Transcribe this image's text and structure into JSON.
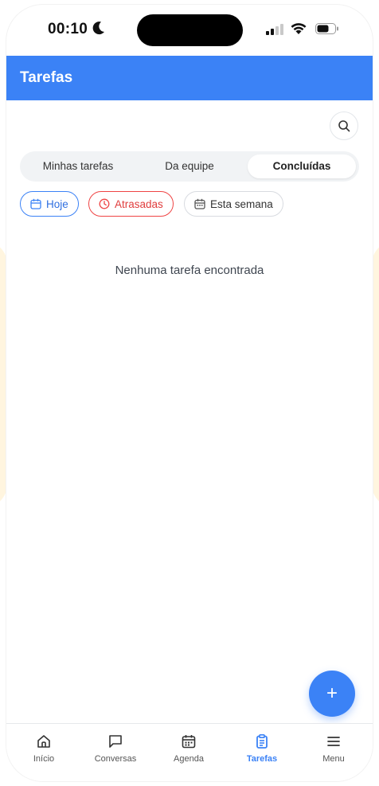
{
  "status_bar": {
    "time": "00:10"
  },
  "header": {
    "title": "Tarefas"
  },
  "segments": [
    {
      "label": "Minhas tarefas"
    },
    {
      "label": "Da equipe"
    },
    {
      "label": "Concluídas",
      "active": true
    }
  ],
  "filters": [
    {
      "label": "Hoje",
      "icon": "calendar-icon",
      "color": "#3b82f6"
    },
    {
      "label": "Atrasadas",
      "icon": "clock-icon",
      "color": "#ef4444"
    },
    {
      "label": "Esta semana",
      "icon": "calendar-week-icon",
      "color": "#555555"
    }
  ],
  "empty_state": {
    "message": "Nenhuma tarefa encontrada"
  },
  "fab": {
    "label": "+"
  },
  "tabbar": {
    "items": [
      {
        "label": "Início",
        "icon": "home-icon"
      },
      {
        "label": "Conversas",
        "icon": "chat-icon"
      },
      {
        "label": "Agenda",
        "icon": "calendar-icon"
      },
      {
        "label": "Tarefas",
        "icon": "clipboard-icon",
        "active": true
      },
      {
        "label": "Menu",
        "icon": "menu-icon"
      }
    ]
  },
  "colors": {
    "accent": "#3b82f6",
    "danger": "#ef4444"
  }
}
